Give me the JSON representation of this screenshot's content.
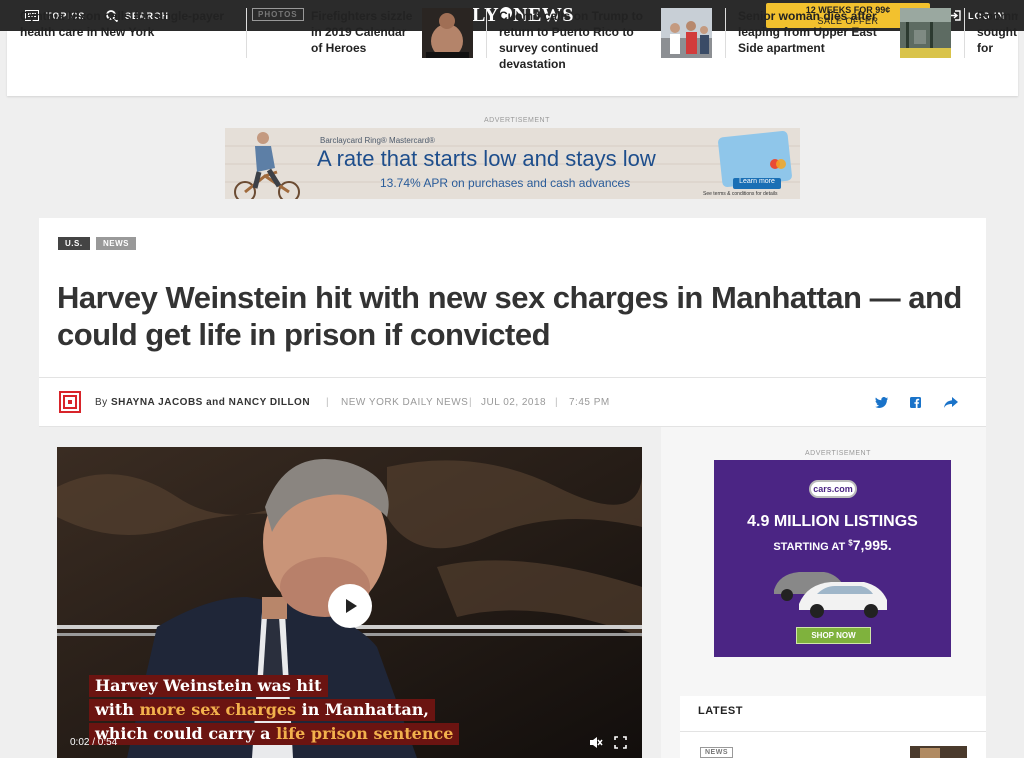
{
  "topbar": {
    "topics_label": "TOPICS",
    "search_label": "SEARCH",
    "logo_left": "DAILY",
    "logo_right": "NEWS",
    "offer_main": "12 WEEKS FOR 99¢",
    "offer_sub": "SALE OFFER",
    "login_label": "LOG IN"
  },
  "strip": {
    "items": [
      {
        "title": "Cynthia Nixon calls for single-payer health care in New York"
      },
      {
        "badge": "PHOTOS",
        "title": "Firefighters sizzle in 2019 Calendar of Heroes"
      },
      {
        "title": "Cuomo calls on Trump to return to Puerto Rico to survey continued devastation"
      },
      {
        "title": "Senior woman dies after leaping from Upper East Side apartment"
      },
      {
        "title": "Roommate sought for death of"
      }
    ]
  },
  "ad_label": "ADVERTISEMENT",
  "banner": {
    "brand": "Barclaycard Ring® Mastercard®",
    "headline": "A rate that starts low and stays low",
    "sub": "13.74% APR on purchases and cash advances",
    "cta": "Learn more",
    "fine": "See terms & conditions for details"
  },
  "article": {
    "tags": [
      "U.S.",
      "NEWS"
    ],
    "headline": "Harvey Weinstein hit with new sex charges in Manhattan — and could get life in prison if convicted",
    "by": "By",
    "authors": "SHAYNA JACOBS and NANCY DILLON",
    "source": "NEW YORK DAILY NEWS",
    "date": "JUL 02, 2018",
    "time": "7:45 PM"
  },
  "video": {
    "cap1": "Harvey Weinstein was hit",
    "cap2a": "with ",
    "cap2b": "more sex charges",
    "cap2c": " in Manhattan,",
    "cap3a": "which could carry a ",
    "cap3b": "life prison sentence",
    "time": "0:02 / 0:54"
  },
  "side_ad": {
    "logo": "cars.com",
    "listings": "4.9 MILLION LISTINGS",
    "starting": "STARTING AT",
    "price": "7,995.",
    "dollar": "$",
    "cta": "SHOP NOW"
  },
  "latest": {
    "title": "LATEST",
    "badge": "NEWS"
  },
  "colors": {
    "offer": "#f2c12e",
    "ad_purple": "#4b2584",
    "accent_blue": "#1a73c9",
    "caption_orange": "#f2b04c"
  }
}
